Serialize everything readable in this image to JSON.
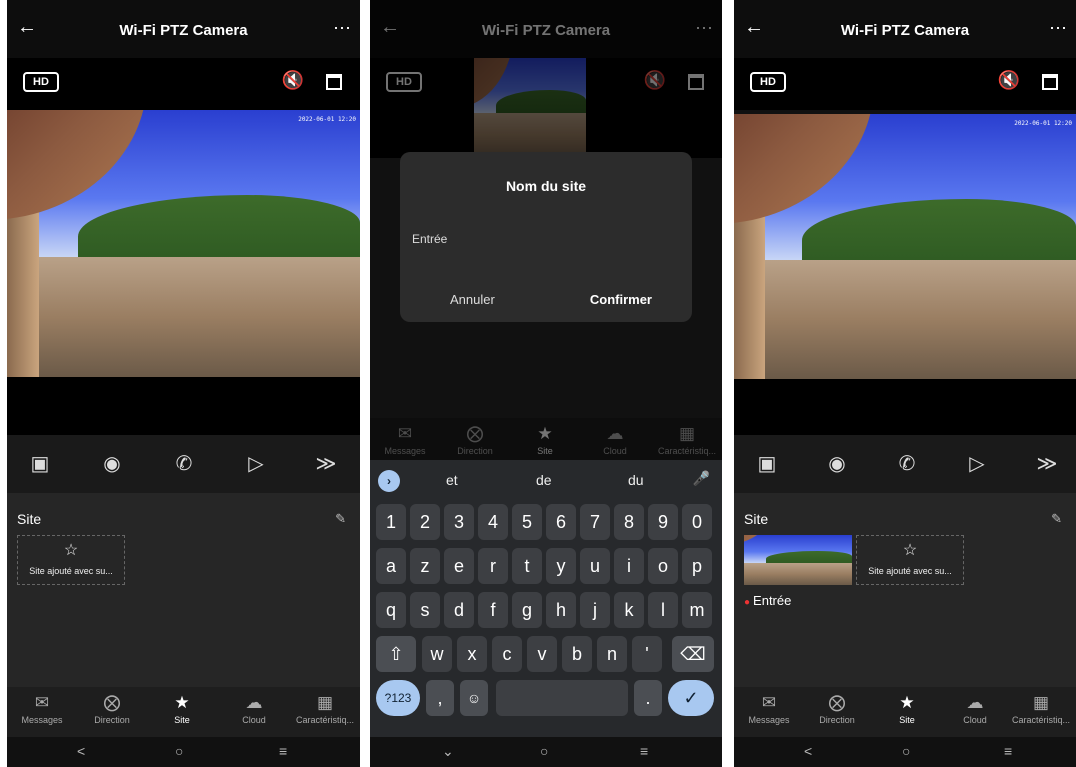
{
  "app": {
    "title": "Wi-Fi PTZ Camera",
    "back_icon": "arrow-left-icon",
    "more_icon": "more-dots-icon",
    "hd_label": "HD",
    "timestamp": "2022-06-01 12:20"
  },
  "site": {
    "title": "Site",
    "card_label": "Site ajouté avec su...",
    "entree_label": "Entrée"
  },
  "tabs": [
    {
      "label": "Messages",
      "icon": "envelope-icon"
    },
    {
      "label": "Direction",
      "icon": "compass-icon"
    },
    {
      "label": "Site",
      "icon": "star-icon"
    },
    {
      "label": "Cloud",
      "icon": "cloud-icon"
    },
    {
      "label": "Caractéristiq...",
      "icon": "grid-icon"
    }
  ],
  "dialog": {
    "title": "Nom du site",
    "input_value": "Entrée",
    "cancel": "Annuler",
    "confirm": "Confirmer"
  },
  "keyboard": {
    "suggestions": [
      "et",
      "de",
      "du"
    ],
    "row_digits": [
      "1",
      "2",
      "3",
      "4",
      "5",
      "6",
      "7",
      "8",
      "9",
      "0"
    ],
    "row1": [
      "a",
      "z",
      "e",
      "r",
      "t",
      "y",
      "u",
      "i",
      "o",
      "p"
    ],
    "row2": [
      "q",
      "s",
      "d",
      "f",
      "g",
      "h",
      "j",
      "k",
      "l",
      "m"
    ],
    "row3": [
      "w",
      "x",
      "c",
      "v",
      "b",
      "n",
      "'"
    ],
    "sym_label": "?123",
    "comma": ",",
    "period": "."
  },
  "navbar": {
    "back": "<",
    "home": "○",
    "recents": "≡"
  },
  "colors": {
    "accent_red": "#e33333",
    "keyboard_accent": "#a8c8f0",
    "background": "#111111"
  }
}
